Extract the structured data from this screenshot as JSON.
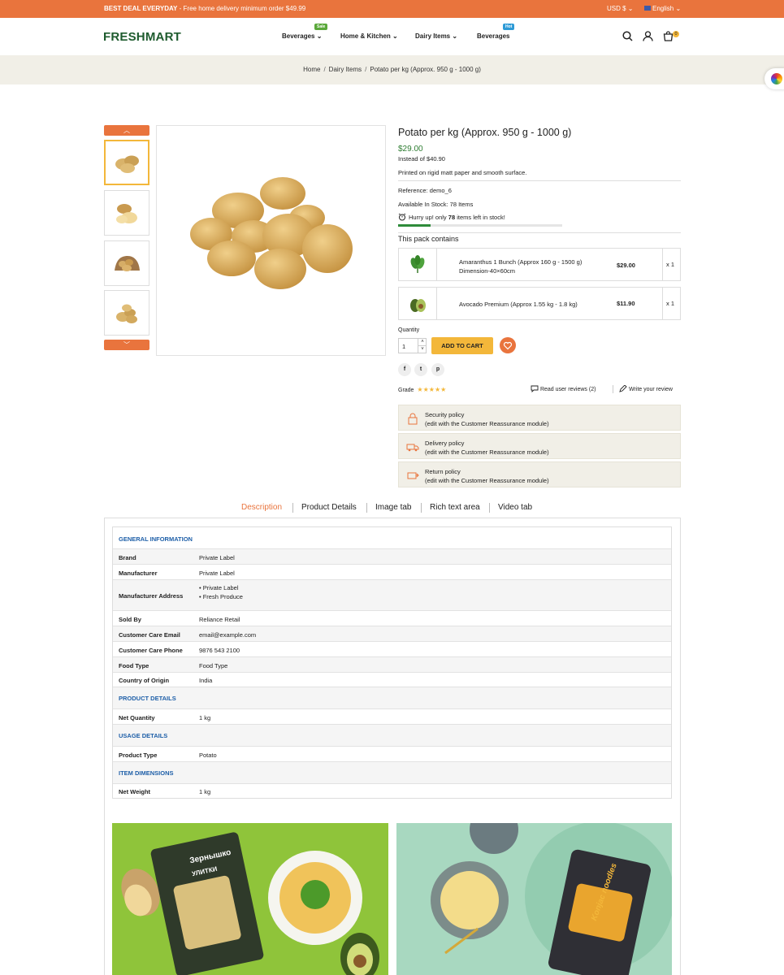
{
  "topbar": {
    "deal_bold": "BEST DEAL EVERYDAY",
    "deal_rest": " - Free home delivery minimum order $49.99",
    "currency": "USD $",
    "language": "English"
  },
  "header": {
    "logo": "FRESHMART",
    "nav": [
      {
        "label": "Beverages",
        "badge": "Sale"
      },
      {
        "label": "Home & Kitchen",
        "badge": ""
      },
      {
        "label": "Dairy Items",
        "badge": ""
      },
      {
        "label": "Beverages",
        "badge": "Hot"
      }
    ],
    "cart_count": "0"
  },
  "breadcrumb": {
    "items": [
      "Home",
      "Dairy Items",
      "Potato per kg (Approx. 950 g - 1000 g)"
    ],
    "separator": "/"
  },
  "product": {
    "title": "Potato per kg (Approx. 950 g - 1000 g)",
    "price": "$29.00",
    "old_price": "Instead of $40.90",
    "short_desc": "Printed on rigid matt paper and smooth surface.",
    "reference": "Reference: demo_6",
    "stock": "Available In Stock: 78 Items",
    "hurry_pre": "Hurry up! only ",
    "hurry_num": "78",
    "hurry_post": " items left in stock!",
    "stock_fraction": 0.2,
    "pack_title": "This pack contains",
    "pack": [
      {
        "name": "Amaranthus 1 Bunch (Approx 160 g - 1500 g)",
        "dim": "Dimension-40×60cm",
        "price": "$29.00",
        "qty": "x 1"
      },
      {
        "name": "Avocado Premium (Approx 1.55 kg - 1.8 kg)",
        "dim": "",
        "price": "$11.90",
        "qty": "x 1"
      }
    ],
    "quantity_label": "Quantity",
    "quantity_value": "1",
    "add_to_cart": "ADD TO CART",
    "social": [
      "f",
      "t",
      "p"
    ],
    "grade_label": "Grade",
    "stars": 5,
    "stars_glyphs": "★★★★★",
    "read_reviews": "Read user reviews (2)",
    "write_review": "Write your review",
    "reassurance": [
      {
        "title": "Security policy",
        "sub": "(edit with the Customer Reassurance module)",
        "icon": "lock-icon"
      },
      {
        "title": "Delivery policy",
        "sub": "(edit with the Customer Reassurance module)",
        "icon": "truck-icon"
      },
      {
        "title": "Return policy",
        "sub": "(edit with the Customer Reassurance module)",
        "icon": "return-icon"
      }
    ]
  },
  "tabs": [
    "Description",
    "Product Details",
    "Image tab",
    "Rich text area",
    "Video tab"
  ],
  "active_tab": "Description",
  "details": {
    "general_title": "GENERAL INFORMATION",
    "general": [
      {
        "k": "Brand",
        "v": "Private Label"
      },
      {
        "k": "Manufacturer",
        "v": "Private Label"
      },
      {
        "k": "Manufacturer Address",
        "list": [
          "Private Label",
          "Fresh Produce"
        ]
      },
      {
        "k": "Sold By",
        "v": "Reliance Retail"
      },
      {
        "k": "Customer Care Email",
        "v": "email@example.com"
      },
      {
        "k": "Customer Care Phone",
        "v": "9876 543 2100"
      },
      {
        "k": "Food Type",
        "v": "Food Type"
      },
      {
        "k": "Country of Origin",
        "v": "India"
      }
    ],
    "product_title": "PRODUCT DETAILS",
    "product": [
      {
        "k": "Net Quantity",
        "v": "1 kg"
      }
    ],
    "usage_title": "USAGE DETAILS",
    "usage": [
      {
        "k": "Product Type",
        "v": "Potato"
      }
    ],
    "dims_title": "ITEM DIMENSIONS",
    "dims": [
      {
        "k": "Net Weight",
        "v": "1 kg"
      }
    ]
  },
  "banners": {
    "left_pack_text": "Зернышко",
    "left_pack_sub": "УЛИТКИ",
    "right_pack_text": "Konjac noodles"
  },
  "colors": {
    "accent": "#e9743d",
    "brand_green": "#1e5b2e",
    "price_green": "#2e7d32",
    "cart_yellow": "#f3b73a",
    "section_blue": "#1e5fa8"
  }
}
